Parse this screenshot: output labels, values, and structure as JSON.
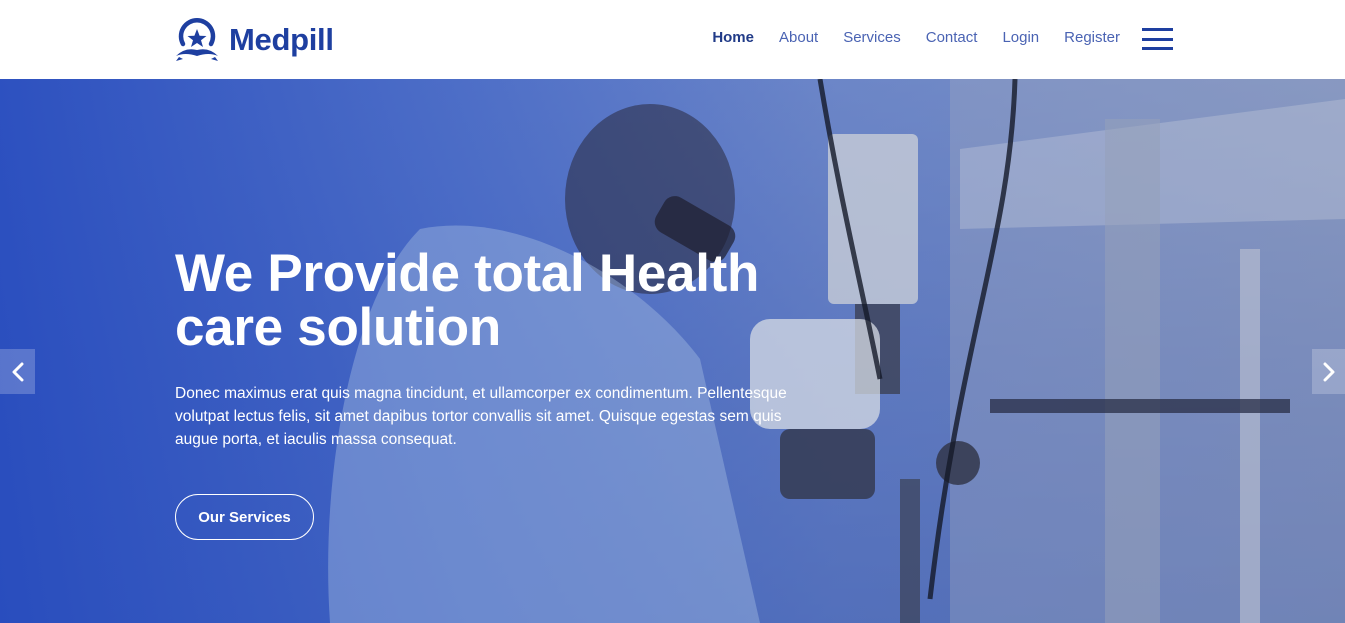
{
  "brand": {
    "name": "Medpill",
    "logo_icon": "star-badge-icon"
  },
  "nav": {
    "items": [
      {
        "label": "Home",
        "active": true
      },
      {
        "label": "About",
        "active": false
      },
      {
        "label": "Services",
        "active": false
      },
      {
        "label": "Contact",
        "active": false
      },
      {
        "label": "Login",
        "active": false
      },
      {
        "label": "Register",
        "active": false
      }
    ],
    "menu_icon": "hamburger-menu-icon"
  },
  "hero": {
    "title": "We Provide total Health care solution",
    "description": "Donec maximus erat quis magna tincidunt, et ullamcorper ex condimentum. Pellentesque volutpat lectus felis, sit amet dapibus tortor convallis sit amet. Quisque egestas sem quis augue porta, et iaculis massa consequat.",
    "button_label": "Our Services",
    "prev_icon": "chevron-left-icon",
    "next_icon": "chevron-right-icon"
  },
  "colors": {
    "brand_blue": "#1e3fa0",
    "nav_link": "#4a63b3",
    "nav_active": "#213b88",
    "hero_overlay": "#2a4fbf"
  }
}
